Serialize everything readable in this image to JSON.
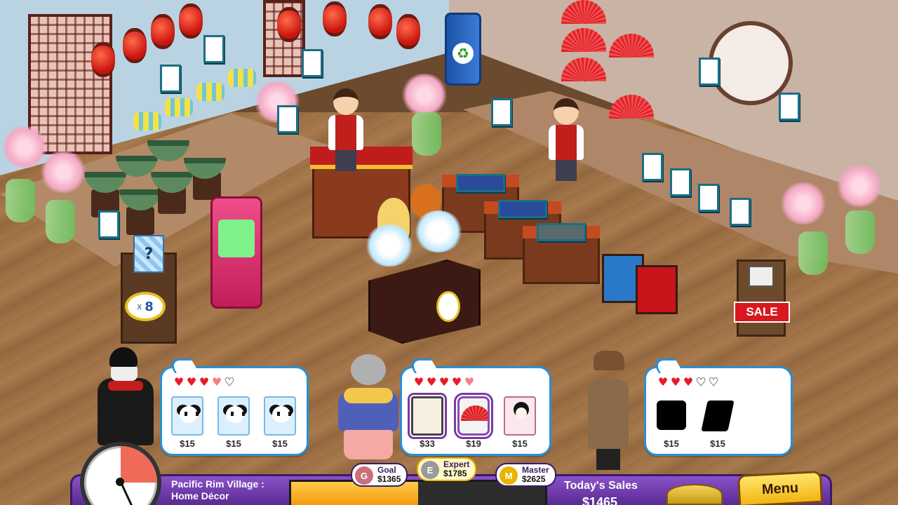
{
  "store": {
    "sale_sign": "SALE",
    "mystery_box": {
      "symbol": "?",
      "multiplier_prefix": "x",
      "count": "8"
    }
  },
  "customers": [
    {
      "name": "gentleman-in-bowler-hat",
      "hearts": [
        "full",
        "full",
        "full",
        "half",
        "empty"
      ],
      "wishes": [
        {
          "item": "panda-poster",
          "price": "$15"
        },
        {
          "item": "panda-poster",
          "price": "$15"
        },
        {
          "item": "panda-poster",
          "price": "$15"
        }
      ]
    },
    {
      "name": "grandmother",
      "hearts": [
        "full",
        "full",
        "full",
        "full",
        "half"
      ],
      "wishes": [
        {
          "item": "scroll-painting",
          "price": "$33"
        },
        {
          "item": "red-fan",
          "price": "$19"
        },
        {
          "item": "geisha-poster",
          "price": "$15"
        }
      ]
    },
    {
      "name": "detective",
      "hearts": [
        "full",
        "full",
        "full",
        "empty",
        "empty"
      ],
      "wishes": [
        {
          "item": "unknown-pillow",
          "price": "$15"
        },
        {
          "item": "unknown-tile",
          "price": "$15"
        }
      ]
    }
  ],
  "hud": {
    "location_line1": "Pacific Rim Village :",
    "location_line2": "Home Décor",
    "day_clock_elapsed_fraction": 0.25,
    "sales_progress_fraction": 0.5,
    "goal": {
      "label": "Goal",
      "amount": "$1365",
      "medal": "G"
    },
    "expert": {
      "label": "Expert",
      "amount": "$1785",
      "medal": "E"
    },
    "master": {
      "label": "Master",
      "amount": "$2625",
      "medal": "M"
    },
    "todays_sales_label": "Today's Sales",
    "todays_sales_value": "$1465",
    "menu_label": "Menu"
  },
  "colors": {
    "hud_purple": "#5a2a92",
    "bubble_border": "#2b8fd3",
    "heart_red": "#e81a2a",
    "menu_gold": "#f2b414",
    "sale_red": "#d9171f"
  }
}
